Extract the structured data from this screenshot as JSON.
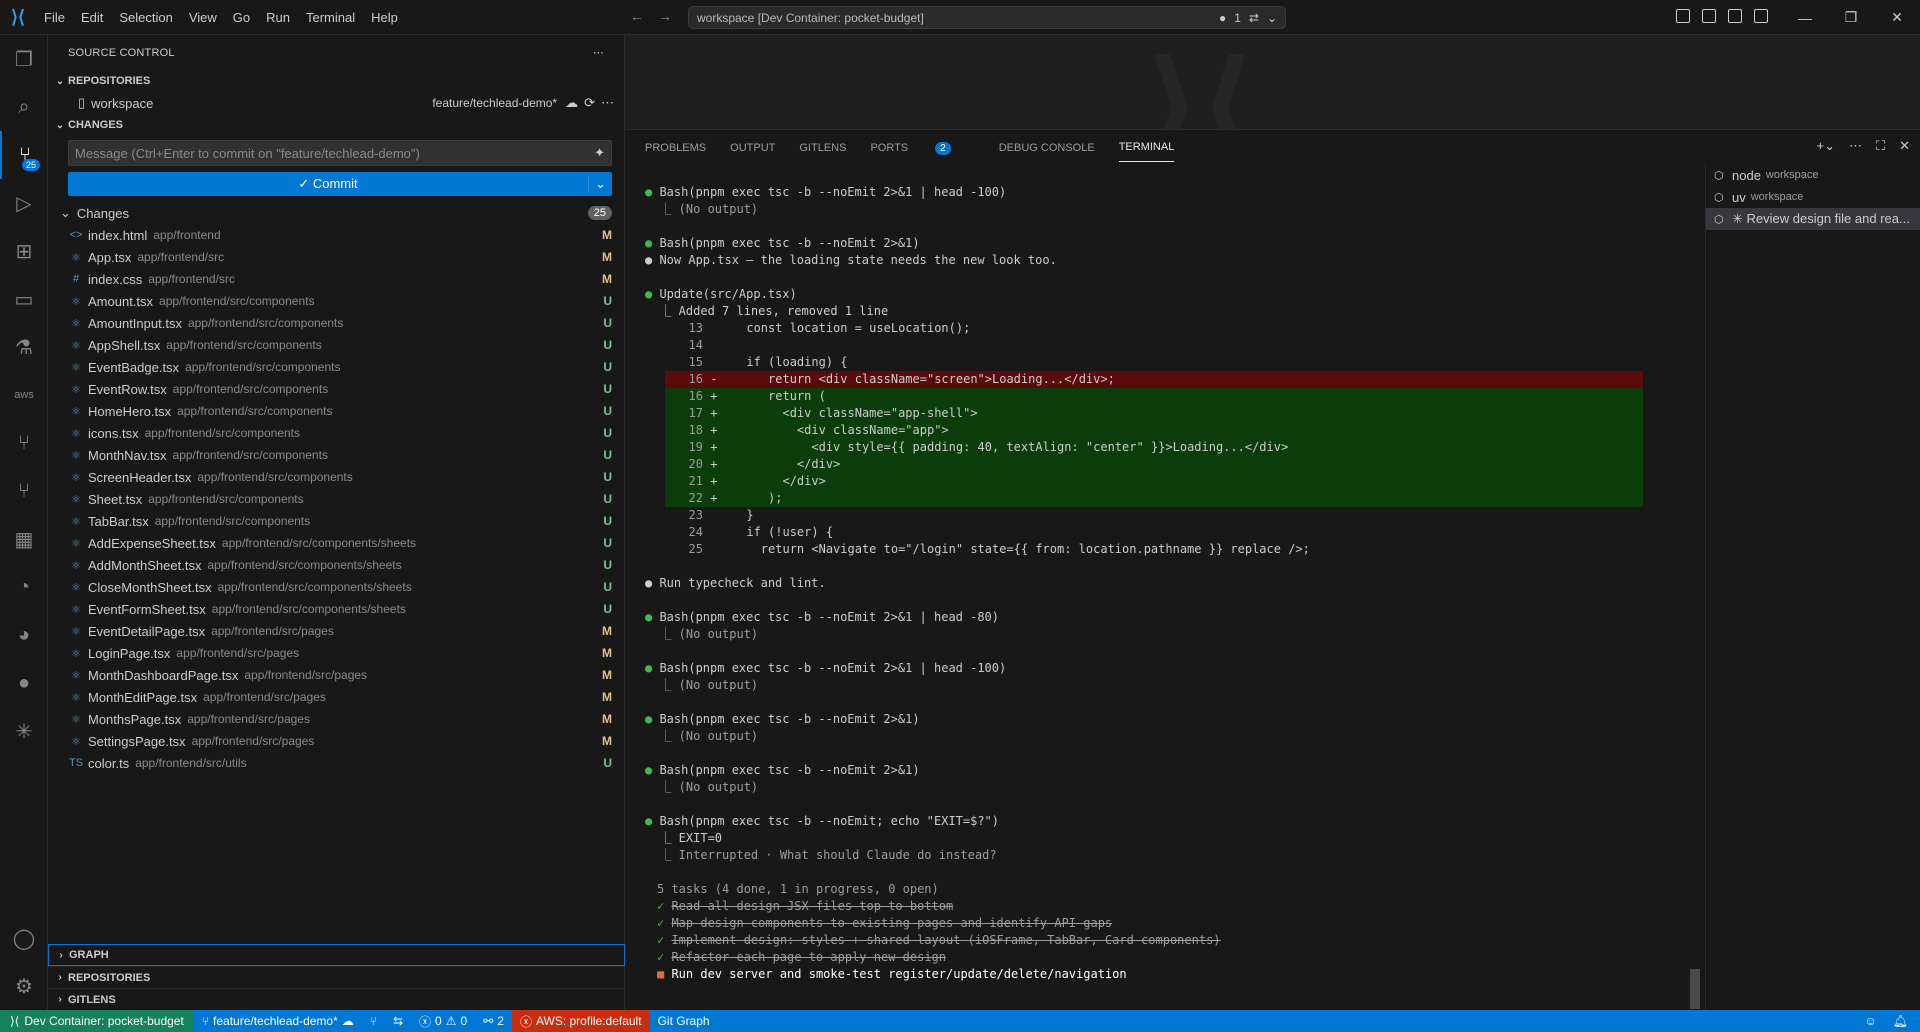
{
  "titlebar": {
    "menu": [
      "File",
      "Edit",
      "Selection",
      "View",
      "Go",
      "Run",
      "Terminal",
      "Help"
    ],
    "command_center": "workspace [Dev Container: pocket-budget]",
    "notif_count": "1"
  },
  "activity": {
    "scm_badge": "25"
  },
  "sidebar": {
    "title": "SOURCE CONTROL",
    "repositories_header": "REPOSITORIES",
    "repo_name": "workspace",
    "repo_branch": "feature/techlead-demo*",
    "changes_header": "CHANGES",
    "message_placeholder": "Message (Ctrl+Enter to commit on \"feature/techlead-demo\")",
    "commit_label": "Commit",
    "changes_group": "Changes",
    "changes_count": "25",
    "files": [
      {
        "icon": "<>",
        "name": "index.html",
        "path": "app/frontend",
        "status": "M"
      },
      {
        "icon": "⚛",
        "name": "App.tsx",
        "path": "app/frontend/src",
        "status": "M"
      },
      {
        "icon": "#",
        "name": "index.css",
        "path": "app/frontend/src",
        "status": "M"
      },
      {
        "icon": "⚛",
        "name": "Amount.tsx",
        "path": "app/frontend/src/components",
        "status": "U"
      },
      {
        "icon": "⚛",
        "name": "AmountInput.tsx",
        "path": "app/frontend/src/components",
        "status": "U"
      },
      {
        "icon": "⚛",
        "name": "AppShell.tsx",
        "path": "app/frontend/src/components",
        "status": "U"
      },
      {
        "icon": "⚛",
        "name": "EventBadge.tsx",
        "path": "app/frontend/src/components",
        "status": "U"
      },
      {
        "icon": "⚛",
        "name": "EventRow.tsx",
        "path": "app/frontend/src/components",
        "status": "U"
      },
      {
        "icon": "⚛",
        "name": "HomeHero.tsx",
        "path": "app/frontend/src/components",
        "status": "U"
      },
      {
        "icon": "⚛",
        "name": "icons.tsx",
        "path": "app/frontend/src/components",
        "status": "U"
      },
      {
        "icon": "⚛",
        "name": "MonthNav.tsx",
        "path": "app/frontend/src/components",
        "status": "U"
      },
      {
        "icon": "⚛",
        "name": "ScreenHeader.tsx",
        "path": "app/frontend/src/components",
        "status": "U"
      },
      {
        "icon": "⚛",
        "name": "Sheet.tsx",
        "path": "app/frontend/src/components",
        "status": "U"
      },
      {
        "icon": "⚛",
        "name": "TabBar.tsx",
        "path": "app/frontend/src/components",
        "status": "U"
      },
      {
        "icon": "⚛",
        "name": "AddExpenseSheet.tsx",
        "path": "app/frontend/src/components/sheets",
        "status": "U"
      },
      {
        "icon": "⚛",
        "name": "AddMonthSheet.tsx",
        "path": "app/frontend/src/components/sheets",
        "status": "U"
      },
      {
        "icon": "⚛",
        "name": "CloseMonthSheet.tsx",
        "path": "app/frontend/src/components/sheets",
        "status": "U"
      },
      {
        "icon": "⚛",
        "name": "EventFormSheet.tsx",
        "path": "app/frontend/src/components/sheets",
        "status": "U"
      },
      {
        "icon": "⚛",
        "name": "EventDetailPage.tsx",
        "path": "app/frontend/src/pages",
        "status": "M"
      },
      {
        "icon": "⚛",
        "name": "LoginPage.tsx",
        "path": "app/frontend/src/pages",
        "status": "M"
      },
      {
        "icon": "⚛",
        "name": "MonthDashboardPage.tsx",
        "path": "app/frontend/src/pages",
        "status": "M"
      },
      {
        "icon": "⚛",
        "name": "MonthEditPage.tsx",
        "path": "app/frontend/src/pages",
        "status": "M"
      },
      {
        "icon": "⚛",
        "name": "MonthsPage.tsx",
        "path": "app/frontend/src/pages",
        "status": "M"
      },
      {
        "icon": "⚛",
        "name": "SettingsPage.tsx",
        "path": "app/frontend/src/pages",
        "status": "M"
      },
      {
        "icon": "TS",
        "name": "color.ts",
        "path": "app/frontend/src/utils",
        "status": "U"
      }
    ],
    "bottom_sections": [
      "GRAPH",
      "REPOSITORIES",
      "GITLENS"
    ]
  },
  "panel": {
    "tabs": [
      "PROBLEMS",
      "OUTPUT",
      "GITLENS",
      "PORTS",
      "DEBUG CONSOLE",
      "TERMINAL"
    ],
    "ports_badge": "2",
    "terminals": [
      {
        "name": "node",
        "sub": "workspace"
      },
      {
        "name": "uv",
        "sub": "workspace"
      },
      {
        "name": "✳ Review design file and rea...",
        "sub": ""
      }
    ]
  },
  "terminal": {
    "l1": "Bash(pnpm exec tsc -b --noEmit 2>&1 | head -100)",
    "l1o": "  ⎿ (No output)",
    "l2": "Bash(pnpm exec tsc -b --noEmit 2>&1)",
    "l3": "Now App.tsx — the loading state needs the new look too.",
    "l4": "Update(src/App.tsx)",
    "l4o": "  ⎿ Added 7 lines, removed 1 line",
    "d13": "    const location = useLocation();",
    "d14": "",
    "d15": "    if (loading) {",
    "d16": "      return <div className=\"screen\">Loading...</div>;",
    "d16a": "      return (",
    "d17": "        <div className=\"app-shell\">",
    "d18": "          <div className=\"app\">",
    "d19": "            <div style={{ padding: 40, textAlign: \"center\" }}>Loading...</div>",
    "d20": "          </div>",
    "d21": "        </div>",
    "d22": "      );",
    "d23": "    }",
    "d24": "    if (!user) {",
    "d25": "      return <Navigate to=\"/login\" state={{ from: location.pathname }} replace />;",
    "l5": "Run typecheck and lint.",
    "l6": "Bash(pnpm exec tsc -b --noEmit 2>&1 | head -80)",
    "l7": "Bash(pnpm exec tsc -b --noEmit 2>&1 | head -100)",
    "l8": "Bash(pnpm exec tsc -b --noEmit 2>&1)",
    "l9": "Bash(pnpm exec tsc -b --noEmit 2>&1)",
    "l10": "Bash(pnpm exec tsc -b --noEmit; echo \"EXIT=$?\")",
    "l10a": "  ⎿ EXIT=0",
    "l10b": "  ⎿ Interrupted · What should Claude do instead?",
    "tasks": "5 tasks (4 done, 1 in progress, 0 open)",
    "t1": "Read all design JSX files top-to-bottom",
    "t2": "Map design components to existing pages and identify API gaps",
    "t3": "Implement design: styles + shared layout (iOSFrame, TabBar, Card components)",
    "t4": "Refactor each page to apply new design",
    "t5": "Run dev server and smoke-test register/update/delete/navigation"
  },
  "status": {
    "remote": "Dev Container: pocket-budget",
    "branch": "feature/techlead-demo*",
    "errors": "0",
    "warnings": "0",
    "ports": "2",
    "aws": "AWS: profile:default",
    "gitgraph": "Git Graph"
  }
}
